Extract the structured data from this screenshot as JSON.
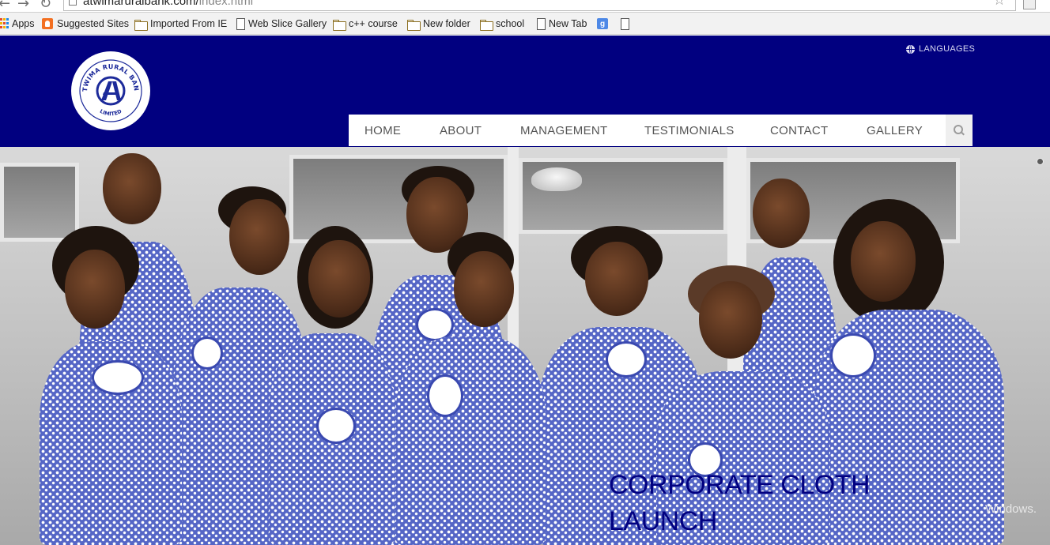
{
  "browser": {
    "url_main": "atwimaruralbank.com/",
    "url_path": "index.html",
    "bookmarks": [
      {
        "label": "Apps",
        "icon": "apps-grid-icon"
      },
      {
        "label": "Suggested Sites",
        "icon": "suggested-sites-icon"
      },
      {
        "label": "Imported From IE",
        "icon": "folder-icon"
      },
      {
        "label": "Web Slice Gallery",
        "icon": "page-icon"
      },
      {
        "label": "c++ course",
        "icon": "folder-icon"
      },
      {
        "label": "New folder",
        "icon": "folder-icon"
      },
      {
        "label": "school",
        "icon": "folder-icon"
      },
      {
        "label": "New Tab",
        "icon": "page-icon"
      },
      {
        "label": "",
        "icon": "google-icon"
      },
      {
        "label": "",
        "icon": "page-icon"
      }
    ]
  },
  "header": {
    "logo_text_top": "ATWIMA RURAL BANK",
    "logo_text_bottom": "LIMITED",
    "languages_label": "LANGUAGES",
    "background_color": "#010080"
  },
  "nav": {
    "items": [
      "HOME",
      "ABOUT",
      "MANAGEMENT",
      "TESTIMONIALS",
      "CONTACT",
      "GALLERY"
    ]
  },
  "hero": {
    "caption_line1": "CORPORATE CLOTH",
    "caption_line2": "LAUNCH",
    "watermark": "Windows.",
    "caption_color": "#010080"
  }
}
